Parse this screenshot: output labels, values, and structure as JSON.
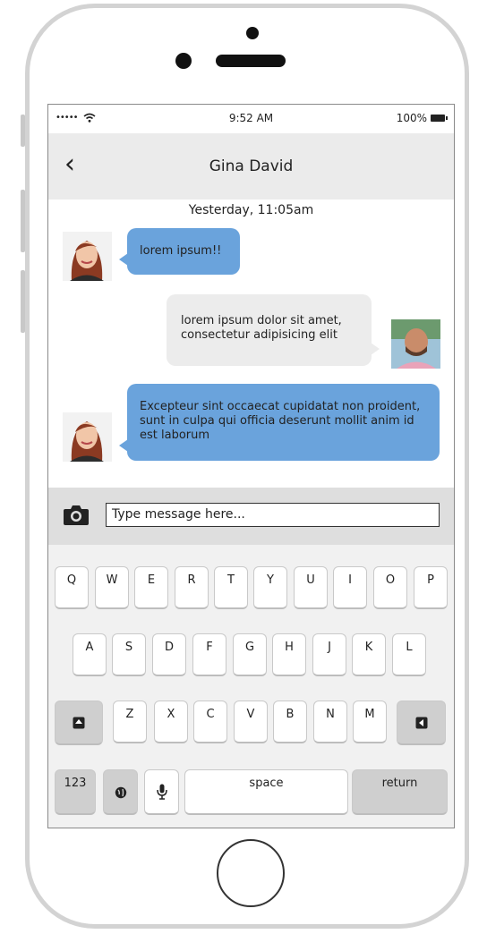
{
  "status_bar": {
    "signal": "•••••",
    "time": "9:52 AM",
    "battery": "100%"
  },
  "header": {
    "back_icon": "chevron-left-icon",
    "back_glyph": "‹",
    "title": "Gina David"
  },
  "chat": {
    "timestamp": "Yesterday, 11:05am",
    "messages": [
      {
        "direction": "incoming",
        "sender": "Gina David",
        "text": "lorem ipsum!!"
      },
      {
        "direction": "outgoing",
        "sender": "me",
        "text": "lorem ipsum dolor sit amet, consectetur adipisicing elit"
      },
      {
        "direction": "incoming",
        "sender": "Gina David",
        "text": "Excepteur sint occaecat cupidatat non proident, sunt in culpa qui officia deserunt mollit anim id est laborum"
      }
    ]
  },
  "composer": {
    "camera_icon": "camera-icon",
    "placeholder": "Type message here..."
  },
  "keyboard": {
    "row1": [
      "Q",
      "W",
      "E",
      "R",
      "T",
      "Y",
      "U",
      "I",
      "O",
      "P"
    ],
    "row2": [
      "A",
      "S",
      "D",
      "F",
      "G",
      "H",
      "J",
      "K",
      "L"
    ],
    "row3": [
      "Z",
      "X",
      "C",
      "V",
      "B",
      "N",
      "M"
    ],
    "shift_icon": "shift-icon",
    "backspace_icon": "backspace-icon",
    "numbers_label": "123",
    "globe_icon": "globe-icon",
    "mic_icon": "microphone-icon",
    "space_label": "space",
    "return_label": "return"
  },
  "colors": {
    "incoming_bubble": "#6aa3dc",
    "outgoing_bubble": "#ececec",
    "header_bg": "#ebebeb",
    "keyboard_bg": "#f1f1f1"
  }
}
